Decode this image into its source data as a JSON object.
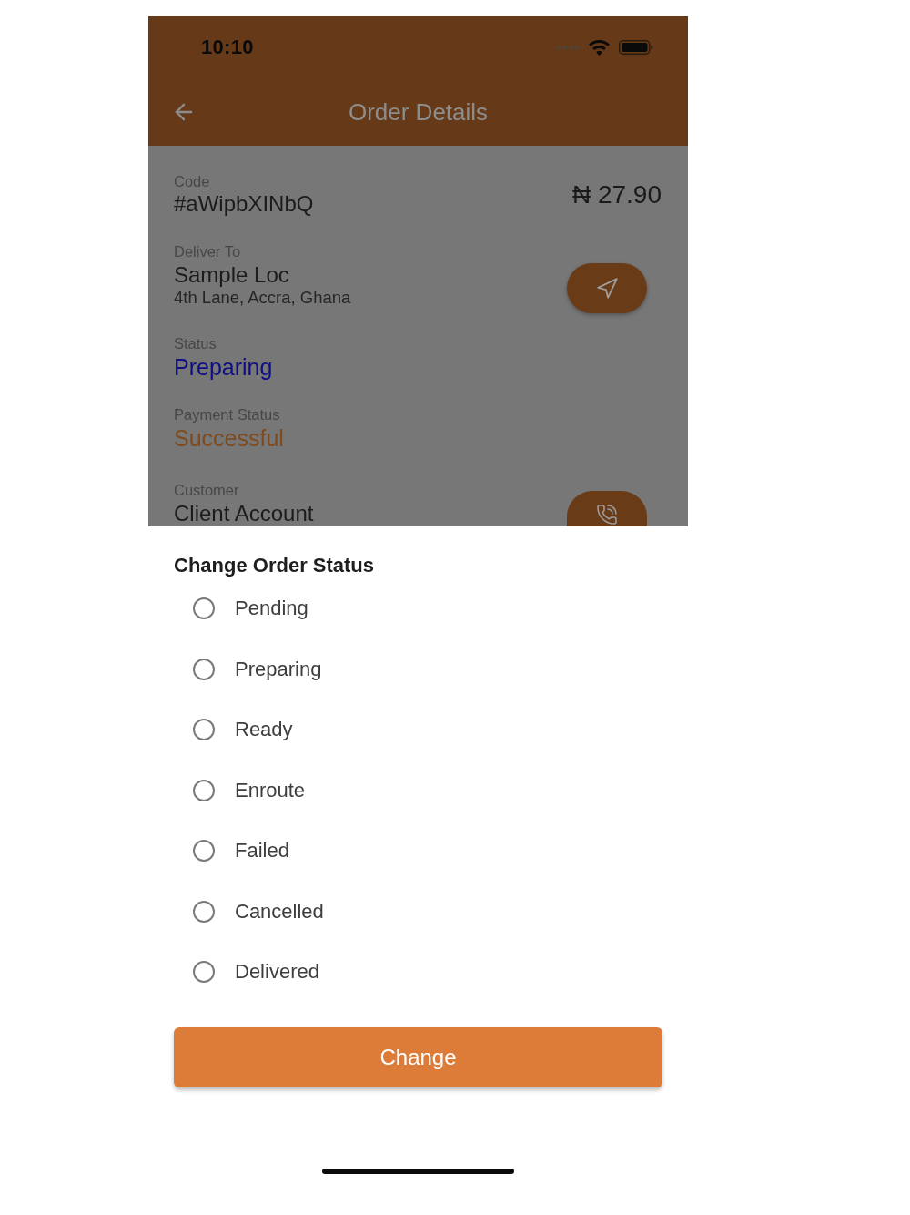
{
  "status_bar": {
    "time": "10:10"
  },
  "app_bar": {
    "title": "Order Details"
  },
  "details": [
    {
      "kind": "code",
      "label": "Code",
      "value": "#aWipbXINbQ",
      "amount": "₦ 27.90"
    },
    {
      "kind": "location",
      "label": "Deliver To",
      "value": "Sample Loc",
      "address": "4th Lane, Accra, Ghana"
    },
    {
      "kind": "order_status",
      "label": "Status",
      "value": "Preparing"
    },
    {
      "kind": "payment_status",
      "label": "Payment Status",
      "value": "Successful"
    },
    {
      "kind": "customer",
      "label": "Customer",
      "value": "Client Account"
    }
  ],
  "sheet": {
    "title": "Change Order Status",
    "options": [
      {
        "label": "Pending",
        "selected": false
      },
      {
        "label": "Preparing",
        "selected": false
      },
      {
        "label": "Ready",
        "selected": false
      },
      {
        "label": "Enroute",
        "selected": false
      },
      {
        "label": "Failed",
        "selected": false
      },
      {
        "label": "Cancelled",
        "selected": false
      },
      {
        "label": "Delivered",
        "selected": false
      }
    ],
    "button": "Change"
  }
}
